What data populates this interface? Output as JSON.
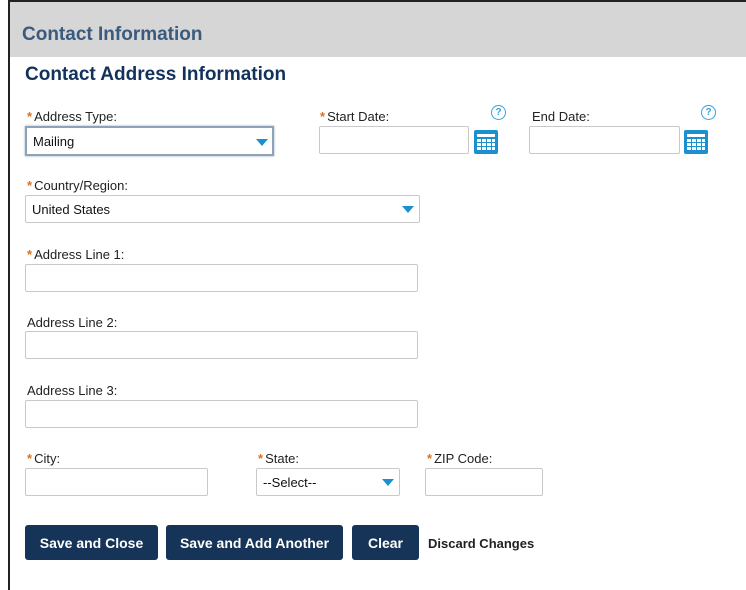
{
  "header": {
    "title": "Contact Information"
  },
  "section": {
    "title": "Contact Address Information"
  },
  "fields": {
    "address_type": {
      "label": "Address Type:",
      "required": "*",
      "value": "Mailing"
    },
    "start_date": {
      "label": "Start Date:",
      "required": "*",
      "value": ""
    },
    "end_date": {
      "label": "End Date:",
      "value": ""
    },
    "country": {
      "label": "Country/Region:",
      "required": "*",
      "value": "United States"
    },
    "address_line_1": {
      "label": "Address Line 1:",
      "required": "*",
      "value": ""
    },
    "address_line_2": {
      "label": "Address Line 2:",
      "value": ""
    },
    "address_line_3": {
      "label": "Address Line 3:",
      "value": ""
    },
    "city": {
      "label": "City:",
      "required": "*",
      "value": ""
    },
    "state": {
      "label": "State:",
      "required": "*",
      "value": "--Select--"
    },
    "zip": {
      "label": "ZIP Code:",
      "required": "*",
      "value": ""
    }
  },
  "help_glyph": "?",
  "buttons": {
    "save_close": "Save and Close",
    "save_add": "Save and Add Another",
    "clear": "Clear",
    "discard": "Discard Changes"
  },
  "colors": {
    "primary_button": "#153457",
    "required_mark": "#e0701e",
    "icon_blue": "#1a8fd1",
    "section_title": "#13325b"
  }
}
